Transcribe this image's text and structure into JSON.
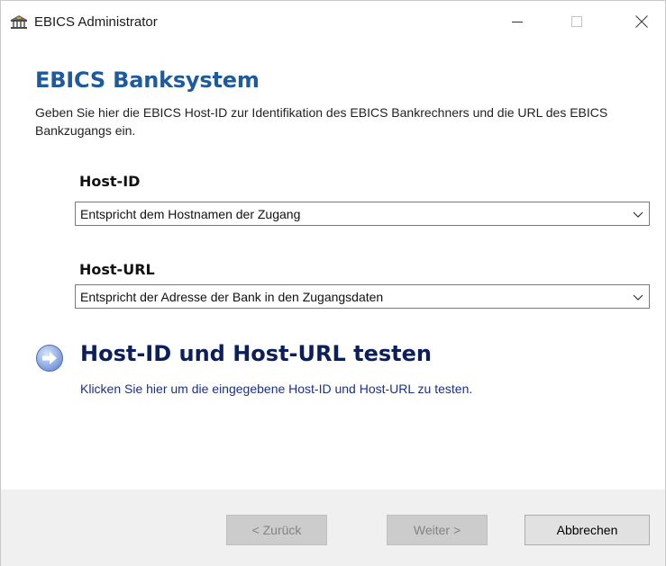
{
  "window": {
    "title": "EBICS Administrator",
    "app_icon": "bank-icon",
    "controls": {
      "minimize": "minimize-icon",
      "maximize": "maximize-icon",
      "close": "close-icon"
    }
  },
  "page": {
    "heading": "EBICS Banksystem",
    "description": "Geben Sie hier die EBICS Host-ID zur Identifikation des EBICS Bankrechners und die URL des EBICS Bankzugangs ein."
  },
  "fields": {
    "host_id": {
      "label": "Host-ID",
      "value": "Entspricht dem Hostnamen der Zugang"
    },
    "host_url": {
      "label": "Host-URL",
      "value": "Entspricht der Adresse der Bank in den Zugangsdaten"
    }
  },
  "test": {
    "icon": "arrow-right-circle-icon",
    "title": "Host-ID und Host-URL testen",
    "description": "Klicken Sie hier um die eingegebene Host-ID und Host-URL zu testen."
  },
  "footer": {
    "back_label": "< Zurück",
    "next_label": "Weiter >",
    "cancel_label": "Abbrechen"
  },
  "colors": {
    "heading": "#1d5a9e",
    "test_title": "#0c1f5a",
    "footer_bg": "#f0f0f0"
  }
}
